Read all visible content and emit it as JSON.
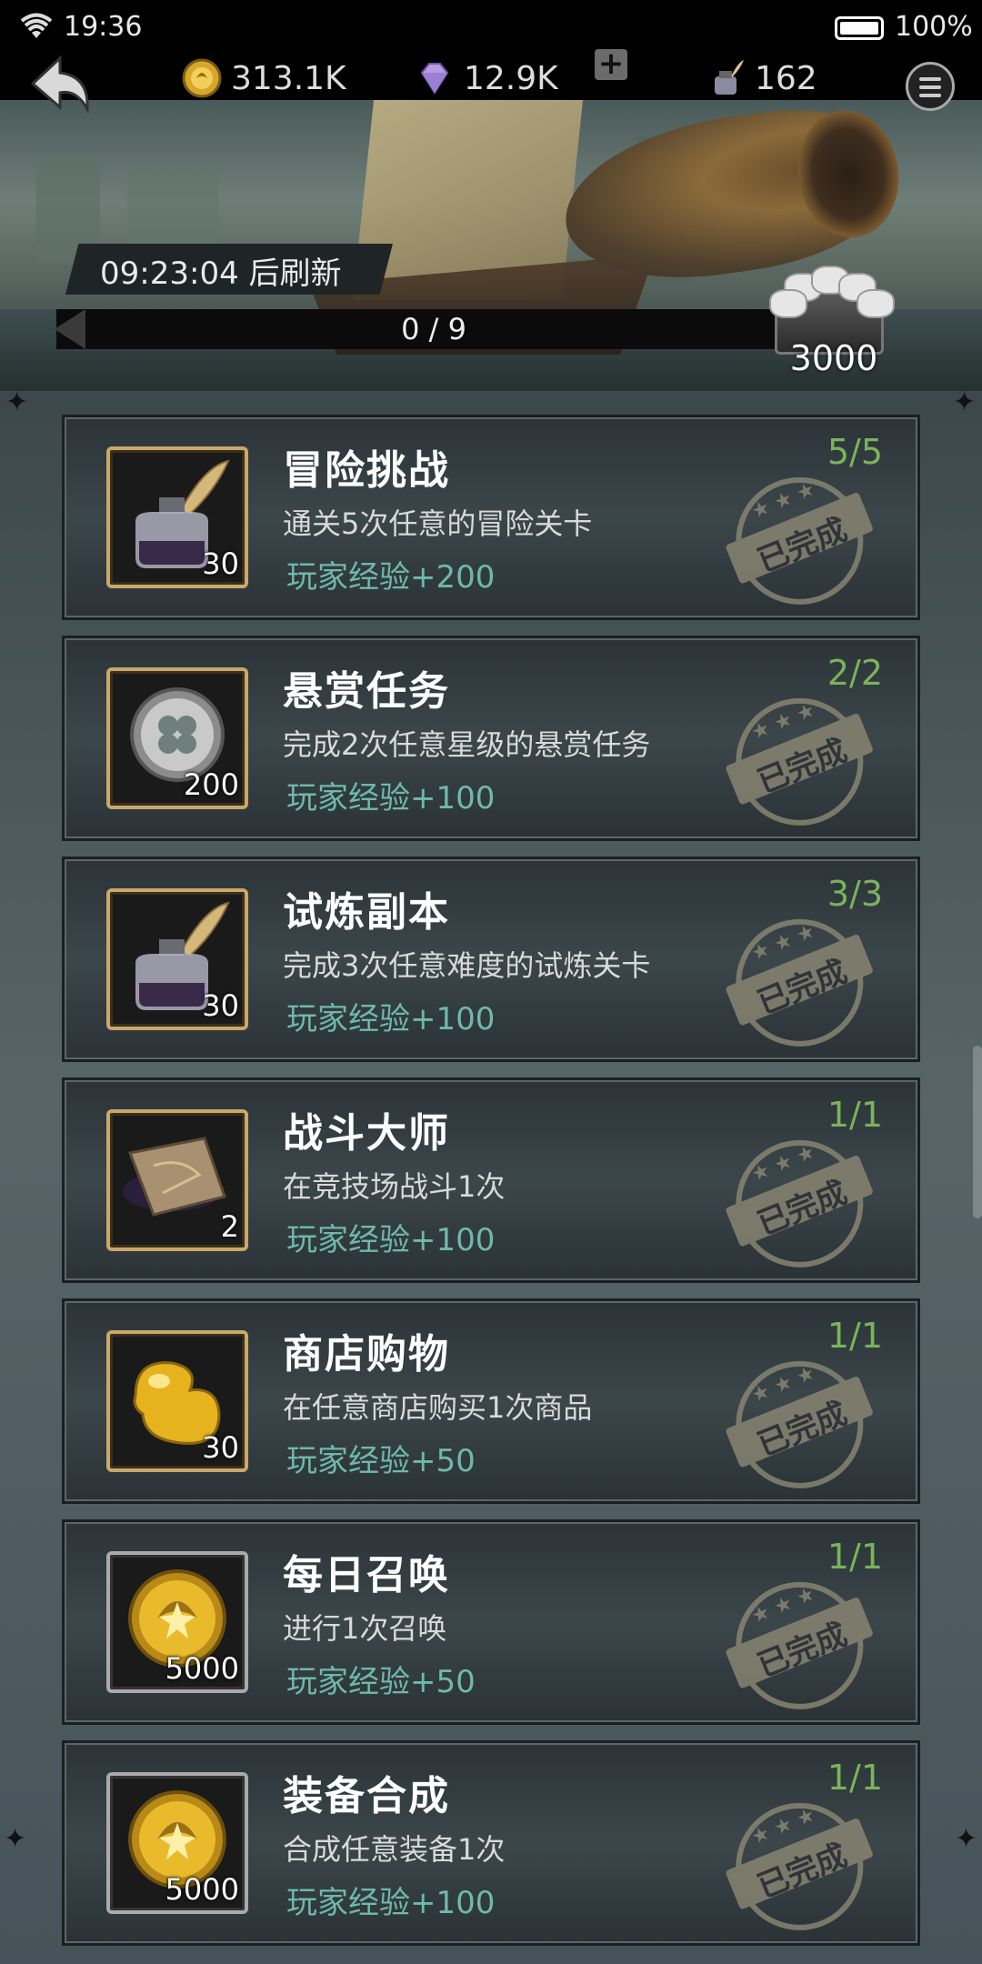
{
  "status_bar": {
    "time": "19:36",
    "battery": "100%"
  },
  "currency": {
    "gold": "313.1K",
    "gems": "12.9K",
    "plus": "+",
    "ink": "162"
  },
  "banner": {
    "refresh_text": "09:23:04 后刷新",
    "progress": "0 / 9",
    "chest_value": "3000"
  },
  "tasks": [
    {
      "title": "冒险挑战",
      "desc": "通关5次任意的冒险关卡",
      "reward": "玩家经验+200",
      "progress": "5/5",
      "icon": "ink-bottle-icon",
      "frame": "gold",
      "count": "30",
      "stamp": "已完成"
    },
    {
      "title": "悬赏任务",
      "desc": "完成2次任意星级的悬赏任务",
      "reward": "玩家经验+100",
      "progress": "2/2",
      "icon": "clover-coin-icon",
      "frame": "gold",
      "count": "200",
      "stamp": "已完成"
    },
    {
      "title": "试炼副本",
      "desc": "完成3次任意难度的试炼关卡",
      "reward": "玩家经验+100",
      "progress": "3/3",
      "icon": "ink-bottle-icon",
      "frame": "gold",
      "count": "30",
      "stamp": "已完成"
    },
    {
      "title": "战斗大师",
      "desc": "在竞技场战斗1次",
      "reward": "玩家经验+100",
      "progress": "1/1",
      "icon": "scroll-icon",
      "frame": "gold",
      "count": "2",
      "stamp": "已完成"
    },
    {
      "title": "商店购物",
      "desc": "在任意商店购买1次商品",
      "reward": "玩家经验+50",
      "progress": "1/1",
      "icon": "golden-bean-icon",
      "frame": "gold",
      "count": "30",
      "stamp": "已完成"
    },
    {
      "title": "每日召唤",
      "desc": "进行1次召唤",
      "reward": "玩家经验+50",
      "progress": "1/1",
      "icon": "gold-coin-icon",
      "frame": "silver",
      "count": "5000",
      "stamp": "已完成"
    },
    {
      "title": "装备合成",
      "desc": "合成任意装备1次",
      "reward": "玩家经验+100",
      "progress": "1/1",
      "icon": "gold-coin-icon",
      "frame": "silver",
      "count": "5000",
      "stamp": "已完成"
    }
  ],
  "colors": {
    "reward": "#6fb8ad",
    "progress": "#7ab35a",
    "gold_frame": "#c9a86a",
    "stamp": "#8b8773"
  }
}
